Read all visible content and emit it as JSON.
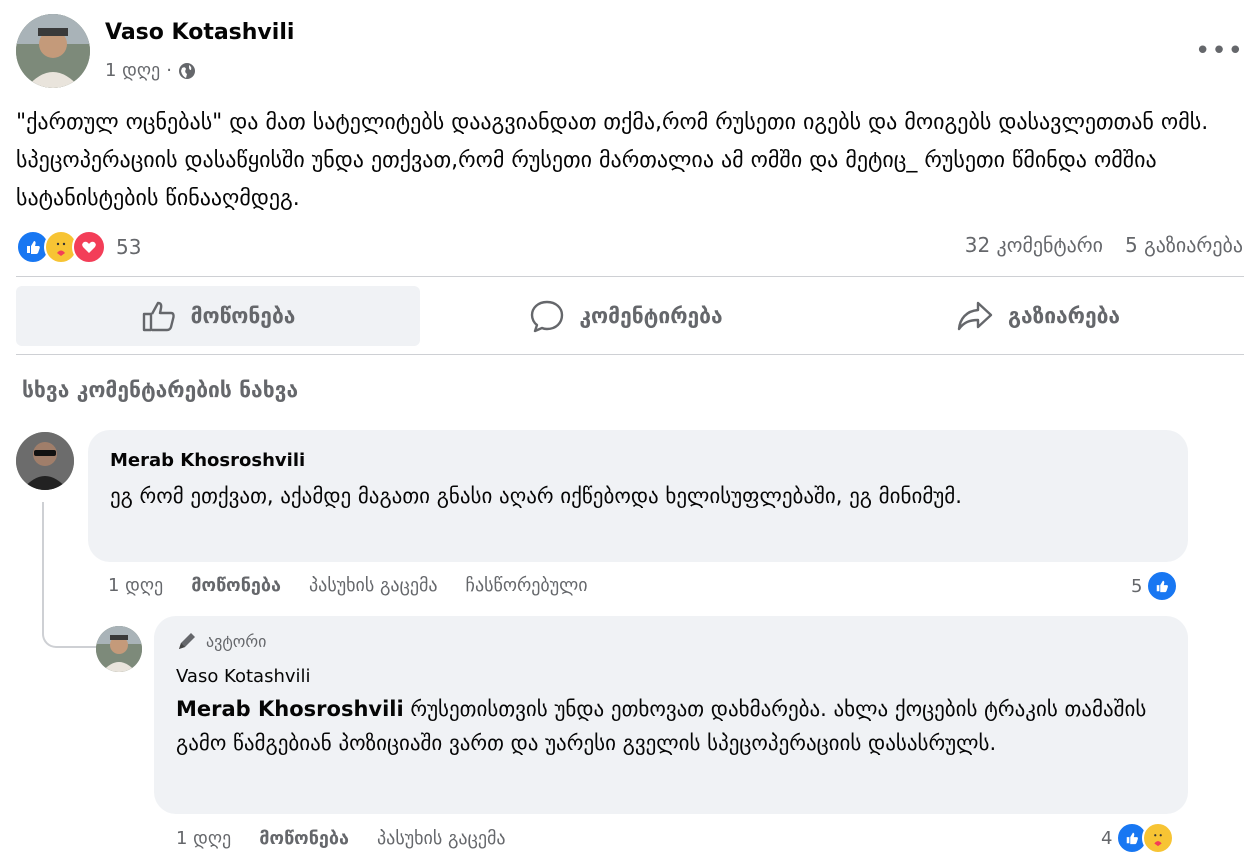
{
  "post": {
    "author": "Vaso Kotashvili",
    "time": "1 დღე",
    "separator": "·",
    "more": "•••",
    "text": "\"ქართულ ოცნებას\" და მათ სატელიტებს დააგვიანდათ  თქმა,რომ რუსეთი იგებს და მოიგებს დასავლეთთან ომს. სპეცოპერაციის დასაწყისში უნდა ეთქვათ,რომ რუსეთი მართალია ამ ომში და მეტიც_ რუსეთი წმინდა ომშია სატანისტების წინააღმდეგ.",
    "reaction_count": "53",
    "comments_count": "32 კომენტარი",
    "shares_count": "5 გაზიარება",
    "reactions": [
      "like",
      "care",
      "love"
    ]
  },
  "actions": {
    "like": "მოწონება",
    "comment": "კომენტირება",
    "share": "გაზიარება"
  },
  "see_more": "სხვა კომენტარების ნახვა",
  "comments": [
    {
      "author": "Merab Khosroshvili",
      "text": "ეგ რომ ეთქვათ, აქამდე მაგათი გნასი აღარ იქწებოდა ხელისუფლებაში, ეგ მინიმუმ.",
      "time": "1 დღე",
      "like": "მოწონება",
      "reply": "პასუხის გაცემა",
      "edited": "ჩასწორებული",
      "reaction_count": "5"
    },
    {
      "badge": "ავტორი",
      "author": "Vaso Kotashvili",
      "mention": "Merab Khosroshvili",
      "text": " რუსეთისთვის უნდა ეთხოვათ დახმარება. ახლა ქოცების ტრაკის თამაშის გამო წამგებიან პოზიციაში ვართ და უარესი გველის სპეცოპერაციის დასასრულს.",
      "time": "1 დღე",
      "like": "მოწონება",
      "reply": "პასუხის გაცემა",
      "reaction_count": "4"
    }
  ],
  "colors": {
    "accent": "#1877f2",
    "bubble": "#f0f2f5",
    "muted": "#65676b"
  }
}
